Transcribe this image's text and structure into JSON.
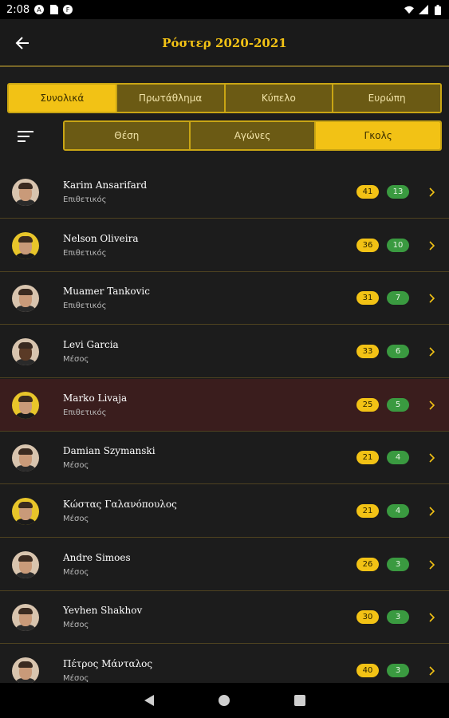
{
  "status_bar": {
    "time": "2:08",
    "icons": [
      "a-circle-icon",
      "sd-card-icon",
      "f-circle-icon"
    ],
    "right_icons": [
      "wifi-icon",
      "cell-signal-icon",
      "battery-icon"
    ]
  },
  "header": {
    "title": "Ρόστερ 2020-2021"
  },
  "competition_tabs": [
    {
      "label": "Συνολικά",
      "active": true
    },
    {
      "label": "Πρωτάθλημα",
      "active": false
    },
    {
      "label": "Κύπελο",
      "active": false
    },
    {
      "label": "Ευρώπη",
      "active": false
    }
  ],
  "sort_tabs": [
    {
      "label": "Θέση",
      "active": false
    },
    {
      "label": "Αγώνες",
      "active": false
    },
    {
      "label": "Γκολς",
      "active": true
    }
  ],
  "players": [
    {
      "name": "Karim Ansarifard",
      "position": "Επιθετικός",
      "apps": "41",
      "goals": "13",
      "highlight": false
    },
    {
      "name": "Nelson Oliveira",
      "position": "Επιθετικός",
      "apps": "36",
      "goals": "10",
      "highlight": false
    },
    {
      "name": "Muamer Tankovic",
      "position": "Επιθετικός",
      "apps": "31",
      "goals": "7",
      "highlight": false
    },
    {
      "name": "Levi Garcia",
      "position": "Μέσος",
      "apps": "33",
      "goals": "6",
      "highlight": false
    },
    {
      "name": "Marko Livaja",
      "position": "Επιθετικός",
      "apps": "25",
      "goals": "5",
      "highlight": true
    },
    {
      "name": "Damian Szymanski",
      "position": "Μέσος",
      "apps": "21",
      "goals": "4",
      "highlight": false
    },
    {
      "name": "Κώστας Γαλανόπουλος",
      "position": "Μέσος",
      "apps": "21",
      "goals": "4",
      "highlight": false
    },
    {
      "name": "Andre Simoes",
      "position": "Μέσος",
      "apps": "26",
      "goals": "3",
      "highlight": false
    },
    {
      "name": "Yevhen Shakhov",
      "position": "Μέσος",
      "apps": "30",
      "goals": "3",
      "highlight": false
    },
    {
      "name": "Πέτρος Μάνταλος",
      "position": "Μέσος",
      "apps": "40",
      "goals": "3",
      "highlight": false
    }
  ],
  "nav_bar": [
    "back-triangle-icon",
    "home-circle-icon",
    "recents-square-icon"
  ],
  "colors": {
    "accent": "#f2c215",
    "tab_inactive": "#6b5a14",
    "goals_badge": "#3a9a40",
    "background": "#1c1c1c",
    "highlight_row": "#3a1d1d"
  }
}
